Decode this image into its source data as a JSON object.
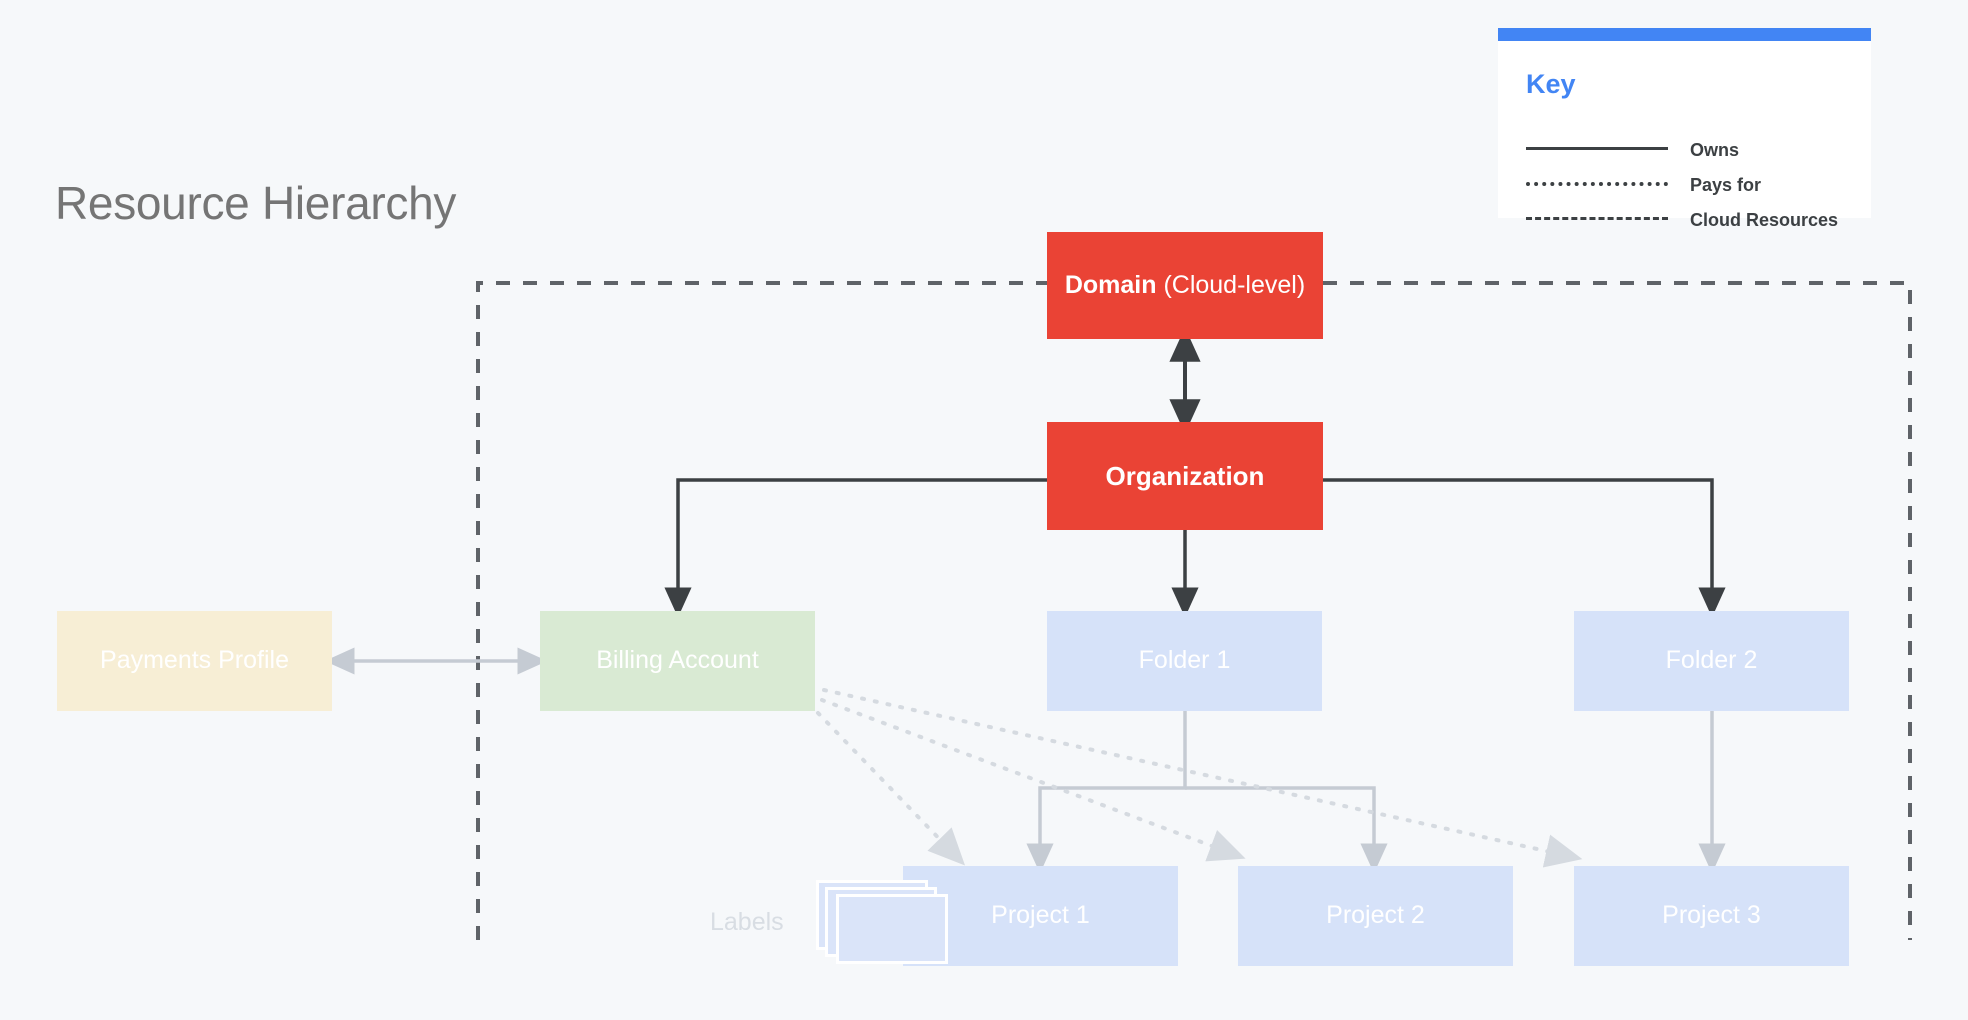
{
  "page": {
    "title": "Resource Hierarchy",
    "background_color": "#f6f8fa"
  },
  "key": {
    "title": "Key",
    "accent_color": "#4285f4",
    "items": [
      {
        "style": "solid",
        "label": "Owns"
      },
      {
        "style": "dotted",
        "label": "Pays for"
      },
      {
        "style": "dashed",
        "label": "Cloud Resources"
      }
    ]
  },
  "nodes": {
    "domain": {
      "label_strong": "Domain",
      "label_rest": " (Cloud-level)",
      "color": "#ea4335"
    },
    "organization": {
      "label": "Organization",
      "color": "#ea4335"
    },
    "payments": {
      "label": "Payments Profile",
      "color": "#f7eed5"
    },
    "billing": {
      "label": "Billing Account",
      "color": "#d9ead3"
    },
    "folder1": {
      "label": "Folder 1",
      "color": "#d6e2f9"
    },
    "folder2": {
      "label": "Folder 2",
      "color": "#d6e2f9"
    },
    "project1": {
      "label": "Project 1",
      "color": "#d6e2f9"
    },
    "project2": {
      "label": "Project 2",
      "color": "#d6e2f9"
    },
    "project3": {
      "label": "Project 3",
      "color": "#d6e2f9"
    },
    "labels": {
      "label": "Labels",
      "color": "#dae4f9"
    }
  },
  "edges": [
    {
      "from": "domain",
      "to": "organization",
      "kind": "owns",
      "arrow": "both"
    },
    {
      "from": "organization",
      "to": "billing",
      "kind": "owns",
      "arrow": "end"
    },
    {
      "from": "organization",
      "to": "folder1",
      "kind": "owns",
      "arrow": "end"
    },
    {
      "from": "organization",
      "to": "folder2",
      "kind": "owns",
      "arrow": "end"
    },
    {
      "from": "payments",
      "to": "billing",
      "kind": "owns",
      "arrow": "both"
    },
    {
      "from": "folder1",
      "to": "project1",
      "kind": "owns",
      "arrow": "end"
    },
    {
      "from": "folder1",
      "to": "project2",
      "kind": "owns",
      "arrow": "end"
    },
    {
      "from": "folder2",
      "to": "project3",
      "kind": "owns",
      "arrow": "end"
    },
    {
      "from": "billing",
      "to": "project1",
      "kind": "pays-for",
      "arrow": "end"
    },
    {
      "from": "billing",
      "to": "project2",
      "kind": "pays-for",
      "arrow": "end"
    },
    {
      "from": "billing",
      "to": "project3",
      "kind": "pays-for",
      "arrow": "end"
    }
  ],
  "cloud_resources_boundary": {
    "style": "dashed",
    "color": "#5f6368"
  }
}
